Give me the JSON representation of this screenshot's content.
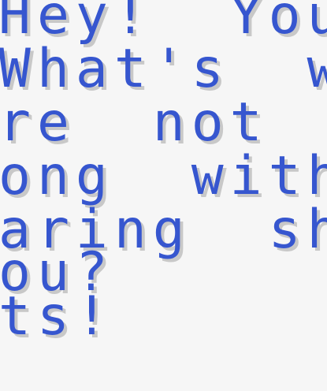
{
  "dialog": {
    "lines": [
      "Hey!  You'r",
      "What's  wro",
      "re  not  wea",
      "ong  with  y",
      "aring  shor",
      "ou?",
      "ts!"
    ]
  },
  "colors": {
    "text": "#3656cf",
    "shadow": "#c8c8c8",
    "background": "#f6f6f6"
  }
}
